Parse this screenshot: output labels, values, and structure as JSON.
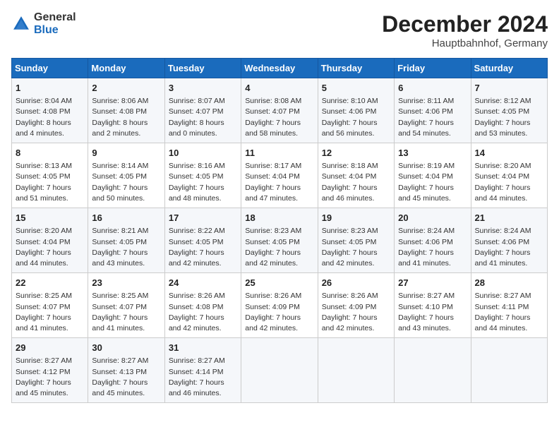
{
  "header": {
    "logo_general": "General",
    "logo_blue": "Blue",
    "month": "December 2024",
    "location": "Hauptbahnhof, Germany"
  },
  "weekdays": [
    "Sunday",
    "Monday",
    "Tuesday",
    "Wednesday",
    "Thursday",
    "Friday",
    "Saturday"
  ],
  "weeks": [
    [
      {
        "day": "1",
        "info": "Sunrise: 8:04 AM\nSunset: 4:08 PM\nDaylight: 8 hours\nand 4 minutes."
      },
      {
        "day": "2",
        "info": "Sunrise: 8:06 AM\nSunset: 4:08 PM\nDaylight: 8 hours\nand 2 minutes."
      },
      {
        "day": "3",
        "info": "Sunrise: 8:07 AM\nSunset: 4:07 PM\nDaylight: 8 hours\nand 0 minutes."
      },
      {
        "day": "4",
        "info": "Sunrise: 8:08 AM\nSunset: 4:07 PM\nDaylight: 7 hours\nand 58 minutes."
      },
      {
        "day": "5",
        "info": "Sunrise: 8:10 AM\nSunset: 4:06 PM\nDaylight: 7 hours\nand 56 minutes."
      },
      {
        "day": "6",
        "info": "Sunrise: 8:11 AM\nSunset: 4:06 PM\nDaylight: 7 hours\nand 54 minutes."
      },
      {
        "day": "7",
        "info": "Sunrise: 8:12 AM\nSunset: 4:05 PM\nDaylight: 7 hours\nand 53 minutes."
      }
    ],
    [
      {
        "day": "8",
        "info": "Sunrise: 8:13 AM\nSunset: 4:05 PM\nDaylight: 7 hours\nand 51 minutes."
      },
      {
        "day": "9",
        "info": "Sunrise: 8:14 AM\nSunset: 4:05 PM\nDaylight: 7 hours\nand 50 minutes."
      },
      {
        "day": "10",
        "info": "Sunrise: 8:16 AM\nSunset: 4:05 PM\nDaylight: 7 hours\nand 48 minutes."
      },
      {
        "day": "11",
        "info": "Sunrise: 8:17 AM\nSunset: 4:04 PM\nDaylight: 7 hours\nand 47 minutes."
      },
      {
        "day": "12",
        "info": "Sunrise: 8:18 AM\nSunset: 4:04 PM\nDaylight: 7 hours\nand 46 minutes."
      },
      {
        "day": "13",
        "info": "Sunrise: 8:19 AM\nSunset: 4:04 PM\nDaylight: 7 hours\nand 45 minutes."
      },
      {
        "day": "14",
        "info": "Sunrise: 8:20 AM\nSunset: 4:04 PM\nDaylight: 7 hours\nand 44 minutes."
      }
    ],
    [
      {
        "day": "15",
        "info": "Sunrise: 8:20 AM\nSunset: 4:04 PM\nDaylight: 7 hours\nand 44 minutes."
      },
      {
        "day": "16",
        "info": "Sunrise: 8:21 AM\nSunset: 4:05 PM\nDaylight: 7 hours\nand 43 minutes."
      },
      {
        "day": "17",
        "info": "Sunrise: 8:22 AM\nSunset: 4:05 PM\nDaylight: 7 hours\nand 42 minutes."
      },
      {
        "day": "18",
        "info": "Sunrise: 8:23 AM\nSunset: 4:05 PM\nDaylight: 7 hours\nand 42 minutes."
      },
      {
        "day": "19",
        "info": "Sunrise: 8:23 AM\nSunset: 4:05 PM\nDaylight: 7 hours\nand 42 minutes."
      },
      {
        "day": "20",
        "info": "Sunrise: 8:24 AM\nSunset: 4:06 PM\nDaylight: 7 hours\nand 41 minutes."
      },
      {
        "day": "21",
        "info": "Sunrise: 8:24 AM\nSunset: 4:06 PM\nDaylight: 7 hours\nand 41 minutes."
      }
    ],
    [
      {
        "day": "22",
        "info": "Sunrise: 8:25 AM\nSunset: 4:07 PM\nDaylight: 7 hours\nand 41 minutes."
      },
      {
        "day": "23",
        "info": "Sunrise: 8:25 AM\nSunset: 4:07 PM\nDaylight: 7 hours\nand 41 minutes."
      },
      {
        "day": "24",
        "info": "Sunrise: 8:26 AM\nSunset: 4:08 PM\nDaylight: 7 hours\nand 42 minutes."
      },
      {
        "day": "25",
        "info": "Sunrise: 8:26 AM\nSunset: 4:09 PM\nDaylight: 7 hours\nand 42 minutes."
      },
      {
        "day": "26",
        "info": "Sunrise: 8:26 AM\nSunset: 4:09 PM\nDaylight: 7 hours\nand 42 minutes."
      },
      {
        "day": "27",
        "info": "Sunrise: 8:27 AM\nSunset: 4:10 PM\nDaylight: 7 hours\nand 43 minutes."
      },
      {
        "day": "28",
        "info": "Sunrise: 8:27 AM\nSunset: 4:11 PM\nDaylight: 7 hours\nand 44 minutes."
      }
    ],
    [
      {
        "day": "29",
        "info": "Sunrise: 8:27 AM\nSunset: 4:12 PM\nDaylight: 7 hours\nand 45 minutes."
      },
      {
        "day": "30",
        "info": "Sunrise: 8:27 AM\nSunset: 4:13 PM\nDaylight: 7 hours\nand 45 minutes."
      },
      {
        "day": "31",
        "info": "Sunrise: 8:27 AM\nSunset: 4:14 PM\nDaylight: 7 hours\nand 46 minutes."
      },
      {
        "day": "",
        "info": ""
      },
      {
        "day": "",
        "info": ""
      },
      {
        "day": "",
        "info": ""
      },
      {
        "day": "",
        "info": ""
      }
    ]
  ]
}
